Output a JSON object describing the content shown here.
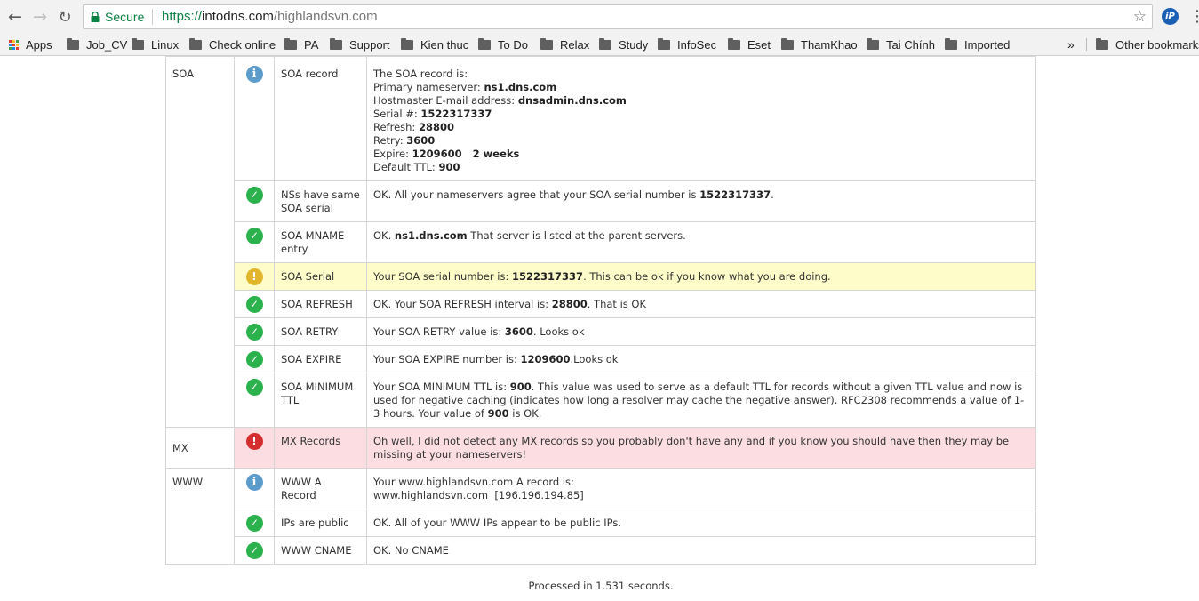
{
  "browser": {
    "secure_label": "Secure",
    "url_scheme": "https://",
    "url_host": "intodns.com",
    "url_path": "/highlandsvn.com",
    "ext_label": "iP",
    "bookmarks": [
      {
        "label": "Apps",
        "type": "apps"
      },
      {
        "label": "Job_CV",
        "type": "folder"
      },
      {
        "label": "Linux",
        "type": "folder"
      },
      {
        "label": "Check online",
        "type": "folder"
      },
      {
        "label": "PA",
        "type": "folder"
      },
      {
        "label": "Support",
        "type": "folder"
      },
      {
        "label": "Kien thuc",
        "type": "folder"
      },
      {
        "label": "To Do",
        "type": "folder"
      },
      {
        "label": "Relax",
        "type": "folder"
      },
      {
        "label": "Study",
        "type": "folder"
      },
      {
        "label": "InfoSec",
        "type": "folder"
      },
      {
        "label": "Eset",
        "type": "folder"
      },
      {
        "label": "ThamKhao",
        "type": "folder"
      },
      {
        "label": "Tai Chính",
        "type": "folder"
      },
      {
        "label": "Imported",
        "type": "folder"
      }
    ],
    "overflow_label": "»",
    "other_bookmarks": "Other bookmarks"
  },
  "report": {
    "soa": {
      "category": "SOA",
      "record": {
        "name": "SOA record",
        "intro": "The SOA record is:",
        "primary_label": "Primary nameserver: ",
        "primary_value": "ns1.dns.com",
        "hostmaster_label": "Hostmaster E-mail address: ",
        "hostmaster_value": "dnsadmin.dns.com",
        "serial_label": "Serial #: ",
        "serial_value": "1522317337",
        "refresh_label": "Refresh: ",
        "refresh_value": "28800",
        "retry_label": "Retry: ",
        "retry_value": "3600",
        "expire_label": "Expire: ",
        "expire_value": "1209600   2 weeks",
        "ttl_label": "Default TTL: ",
        "ttl_value": "900"
      },
      "same_serial": {
        "name": "NSs have same SOA serial",
        "pre": "OK. All your nameservers agree that your SOA serial number is ",
        "value": "1522317337",
        "post": "."
      },
      "mname": {
        "name": "SOA MNAME entry",
        "pre": "OK. ",
        "value": "ns1.dns.com",
        "post": " That server is listed at the parent servers."
      },
      "serial": {
        "name": "SOA Serial",
        "pre": "Your SOA serial number is: ",
        "value": "1522317337",
        "post": ". This can be ok if you know what you are doing."
      },
      "refresh": {
        "name": "SOA REFRESH",
        "pre": "OK. Your SOA REFRESH interval is: ",
        "value": "28800",
        "post": ". That is OK"
      },
      "retry": {
        "name": "SOA RETRY",
        "pre": "Your SOA RETRY value is: ",
        "value": "3600",
        "post": ". Looks ok"
      },
      "expire": {
        "name": "SOA EXPIRE",
        "pre": "Your SOA EXPIRE number is: ",
        "value": "1209600",
        "post": ".Looks ok"
      },
      "minimum": {
        "name": "SOA MINIMUM TTL",
        "pre": "Your SOA MINIMUM TTL is: ",
        "value": "900",
        "mid": ". This value was used to serve as a default TTL for records without a given TTL value and now is used for negative caching (indicates how long a resolver may cache the negative answer). RFC2308 recommends a value of 1-3 hours. Your value of ",
        "value2": "900",
        "post": " is OK."
      }
    },
    "mx": {
      "category": "MX",
      "records": {
        "name": "MX Records",
        "text": "Oh well, I did not detect any MX records so you probably don't have any and if you know you should have then they may be missing at your nameservers!"
      }
    },
    "www": {
      "category": "WWW",
      "a_record": {
        "name": "WWW A Record",
        "line1": "Your www.highlandsvn.com A record is:",
        "line2": "www.highlandsvn.com  [196.196.194.85]"
      },
      "public": {
        "name": "IPs are public",
        "text": "OK. All of your WWW IPs appear to be public IPs."
      },
      "cname": {
        "name": "WWW CNAME",
        "text": "OK. No CNAME"
      }
    },
    "icons": {
      "ok": "✓",
      "info": "i",
      "warn": "!",
      "error": "!"
    },
    "colors": {
      "ok": "#2bb24c",
      "info": "#5c9ccc",
      "warn": "#e3b52b",
      "error": "#d62e2e",
      "warn_bg": "#fefdc9",
      "error_bg": "#fbdde2"
    }
  },
  "footer": {
    "processed": "Processed in 1.531 seconds."
  }
}
